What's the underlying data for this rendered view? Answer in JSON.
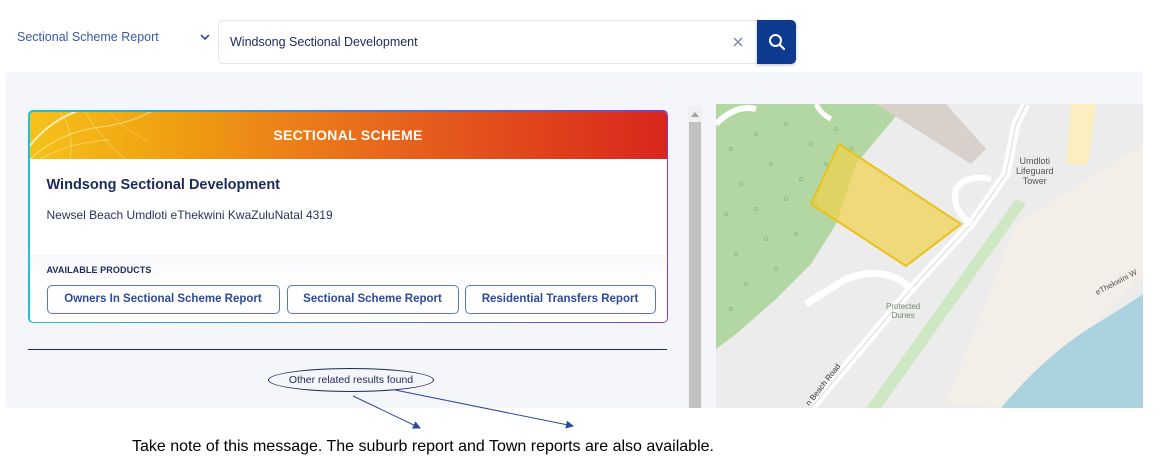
{
  "search": {
    "type_selected": "Sectional Scheme Report",
    "query": "Windsong Sectional Development"
  },
  "result_card": {
    "banner_title": "SECTIONAL SCHEME",
    "name": "Windsong Sectional Development",
    "address": "Newsel Beach Umdloti eThekwini KwaZuluNatal 4319",
    "products_label": "AVAILABLE PRODUCTS",
    "products": [
      "Owners In Sectional Scheme Report",
      "Sectional Scheme Report",
      "Residential Transfers Report"
    ]
  },
  "related_message": "Other related results found",
  "map": {
    "labels": {
      "lifeguard_line1": "Umdloti",
      "lifeguard_line2": "Lifeguard",
      "lifeguard_line3": "Tower",
      "dunes_line1": "Protected",
      "dunes_line2": "Dunes",
      "road": "n Beach Road",
      "ethekwini": "eThekwini W"
    },
    "colors": {
      "background": "#ececec",
      "park": "#a9d49a",
      "sea": "#aad3df",
      "highlight_fill": "#f2d24a",
      "highlight_stroke": "#e8c21a"
    }
  },
  "annotation_note": "Take note of this message. The suburb report and Town reports are also available.",
  "colors": {
    "primary": "#0e3a8f",
    "text_dark": "#1b2a5a",
    "link_blue": "#3a5aa8"
  }
}
